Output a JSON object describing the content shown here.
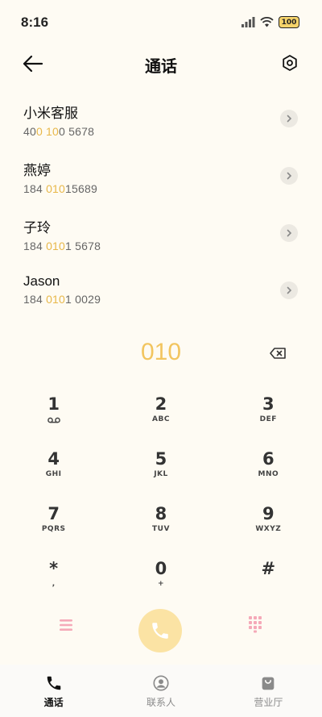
{
  "status_bar": {
    "time": "8:16",
    "battery": "100"
  },
  "header": {
    "title": "通话"
  },
  "contacts": [
    {
      "name": "小米客服",
      "number_parts": [
        "40",
        "0 10",
        "0 5678"
      ]
    },
    {
      "name": "燕婷",
      "number_parts": [
        "184 ",
        "010",
        "15689"
      ]
    },
    {
      "name": "子玲",
      "number_parts": [
        "184 ",
        "010",
        "1 5678"
      ]
    },
    {
      "name": "Jason",
      "number_parts": [
        "184 ",
        "010",
        "1 0029"
      ]
    }
  ],
  "dialer": {
    "input": "010"
  },
  "keypad": [
    [
      {
        "digit": "1",
        "letters": ""
      },
      {
        "digit": "2",
        "letters": "ABC"
      },
      {
        "digit": "3",
        "letters": "DEF"
      }
    ],
    [
      {
        "digit": "4",
        "letters": "GHI"
      },
      {
        "digit": "5",
        "letters": "JKL"
      },
      {
        "digit": "6",
        "letters": "MNO"
      }
    ],
    [
      {
        "digit": "7",
        "letters": "PQRS"
      },
      {
        "digit": "8",
        "letters": "TUV"
      },
      {
        "digit": "9",
        "letters": "WXYZ"
      }
    ],
    [
      {
        "digit": "*",
        "letters": ","
      },
      {
        "digit": "0",
        "letters": "+"
      },
      {
        "digit": "#",
        "letters": ""
      }
    ]
  ],
  "tabs": [
    {
      "label": "通话",
      "icon": "phone-icon",
      "active": true
    },
    {
      "label": "联系人",
      "icon": "contact-icon",
      "active": false
    },
    {
      "label": "营业厅",
      "icon": "shop-bag-icon",
      "active": false
    }
  ],
  "colors": {
    "accent": "#F2C55F",
    "call_button": "#FBE3A4",
    "pink": "#F5A9B8"
  }
}
